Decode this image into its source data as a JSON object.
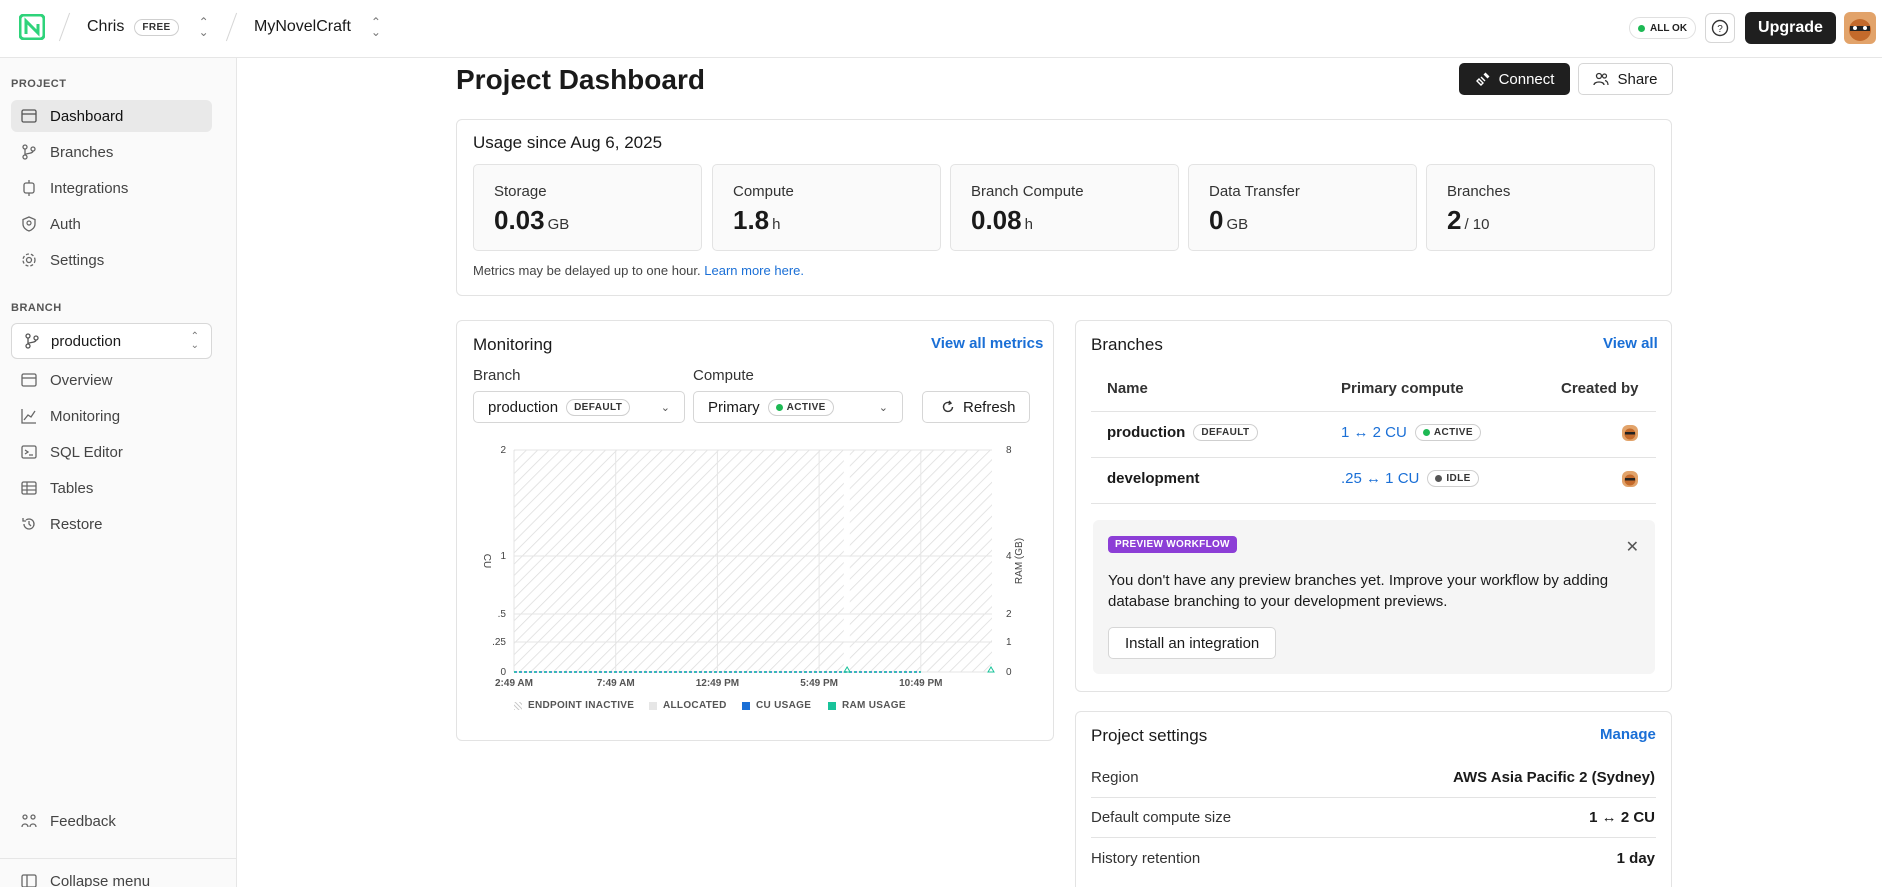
{
  "header": {
    "user_name": "Chris",
    "plan_badge": "FREE",
    "project_name": "MyNovelCraft",
    "status": "ALL OK",
    "status_color": "#1db954",
    "upgrade_label": "Upgrade"
  },
  "sidebar": {
    "project_section": "PROJECT",
    "project_items": [
      {
        "label": "Dashboard",
        "icon": "dashboard-icon",
        "active": true
      },
      {
        "label": "Branches",
        "icon": "branch-icon"
      },
      {
        "label": "Integrations",
        "icon": "integrations-icon"
      },
      {
        "label": "Auth",
        "icon": "auth-icon"
      },
      {
        "label": "Settings",
        "icon": "gear-icon"
      }
    ],
    "branch_section": "BRANCH",
    "branch_selected": "production",
    "branch_items": [
      {
        "label": "Overview",
        "icon": "overview-icon"
      },
      {
        "label": "Monitoring",
        "icon": "monitoring-icon"
      },
      {
        "label": "SQL Editor",
        "icon": "sql-editor-icon"
      },
      {
        "label": "Tables",
        "icon": "tables-icon"
      },
      {
        "label": "Restore",
        "icon": "restore-icon"
      }
    ],
    "feedback": "Feedback",
    "collapse": "Collapse menu"
  },
  "page": {
    "title": "Project Dashboard",
    "connect_label": "Connect",
    "share_label": "Share"
  },
  "usage": {
    "title": "Usage since Aug 6, 2025",
    "metrics": [
      {
        "label": "Storage",
        "value": "0.03",
        "unit": "GB"
      },
      {
        "label": "Compute",
        "value": "1.8",
        "unit": "h"
      },
      {
        "label": "Branch Compute",
        "value": "0.08",
        "unit": "h"
      },
      {
        "label": "Data Transfer",
        "value": "0",
        "unit": "GB"
      },
      {
        "label": "Branches",
        "value": "2",
        "unit": "/ 10"
      }
    ],
    "note": "Metrics may be delayed up to one hour.",
    "note_link": "Learn more here."
  },
  "monitoring": {
    "title": "Monitoring",
    "view_all": "View all metrics",
    "branch_label": "Branch",
    "branch_value": "production",
    "branch_badge": "DEFAULT",
    "compute_label": "Compute",
    "compute_value": "Primary",
    "compute_badge": "ACTIVE",
    "refresh_label": "Refresh",
    "legend": [
      "ENDPOINT INACTIVE",
      "ALLOCATED",
      "CU USAGE",
      "RAM USAGE"
    ]
  },
  "chart_data": {
    "type": "area",
    "x": [
      "2:49 AM",
      "7:49 AM",
      "12:49 PM",
      "5:49 PM",
      "10:49 PM"
    ],
    "ylabel": "CU",
    "y2label": "RAM (GB)",
    "y_ticks": [
      "0",
      ".25",
      ".5",
      "1",
      "2"
    ],
    "y2_ticks": [
      "0",
      "1",
      "2",
      "4",
      "8"
    ],
    "ylim": [
      0,
      2
    ],
    "y2lim": [
      0,
      8
    ],
    "series": [
      {
        "name": "CU USAGE",
        "color": "#1a6fd6",
        "values": [
          0,
          0,
          0,
          0,
          0
        ]
      },
      {
        "name": "RAM USAGE",
        "color": "#19c39a",
        "values": [
          0,
          0,
          0,
          0,
          0
        ]
      }
    ]
  },
  "branches": {
    "title": "Branches",
    "view_all": "View all",
    "columns": [
      "Name",
      "Primary compute",
      "Created by"
    ],
    "rows": [
      {
        "name": "production",
        "badge": "DEFAULT",
        "compute": "1 ↔ 2 CU",
        "status": "ACTIVE",
        "status_color": "#1db954"
      },
      {
        "name": "development",
        "badge": "",
        "compute": ".25 ↔ 1 CU",
        "status": "IDLE",
        "status_color": "#555555"
      }
    ],
    "preview_badge": "PREVIEW WORKFLOW",
    "preview_text": "You don't have any preview branches yet. Improve your workflow by adding database branching to your development previews.",
    "preview_button": "Install an integration"
  },
  "settings": {
    "title": "Project settings",
    "manage": "Manage",
    "rows": [
      {
        "label": "Region",
        "value": "AWS Asia Pacific 2 (Sydney)"
      },
      {
        "label": "Default compute size",
        "value": "1 ↔ 2 CU"
      },
      {
        "label": "History retention",
        "value": "1 day"
      }
    ]
  }
}
